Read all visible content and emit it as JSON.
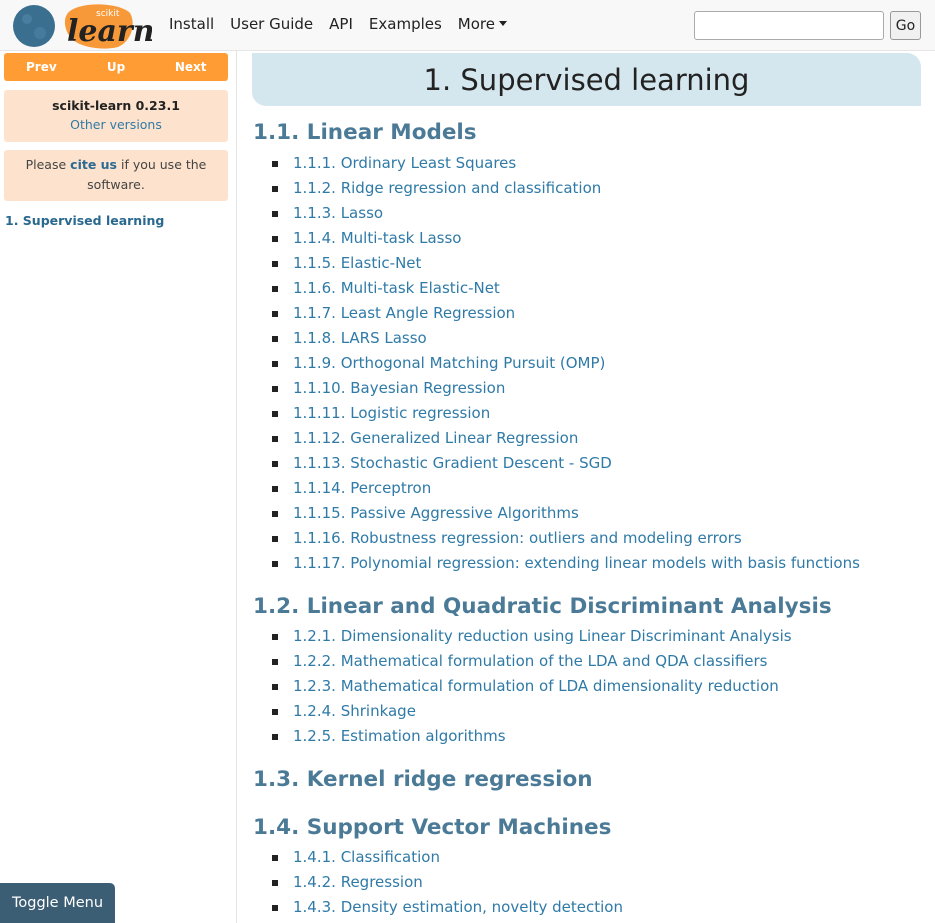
{
  "logo": {
    "small_text": "scikit",
    "big_text": "learn"
  },
  "nav": {
    "links": [
      "Install",
      "User Guide",
      "API",
      "Examples"
    ],
    "more_label": "More",
    "search_placeholder": "",
    "go_label": "Go"
  },
  "sidebar": {
    "prev": "Prev",
    "up": "Up",
    "next": "Next",
    "version": "scikit-learn 0.23.1",
    "other_versions": "Other versions",
    "cite_before": "Please ",
    "cite_link": "cite us",
    "cite_after": " if you use the software.",
    "current_page": "1. Supervised learning",
    "toggle_menu": "Toggle Menu"
  },
  "page": {
    "title": "1. Supervised learning",
    "sections": [
      {
        "heading": "1.1. Linear Models",
        "items": [
          "1.1.1. Ordinary Least Squares",
          "1.1.2. Ridge regression and classification",
          "1.1.3. Lasso",
          "1.1.4. Multi-task Lasso",
          "1.1.5. Elastic-Net",
          "1.1.6. Multi-task Elastic-Net",
          "1.1.7. Least Angle Regression",
          "1.1.8. LARS Lasso",
          "1.1.9. Orthogonal Matching Pursuit (OMP)",
          "1.1.10. Bayesian Regression",
          "1.1.11. Logistic regression",
          "1.1.12. Generalized Linear Regression",
          "1.1.13. Stochastic Gradient Descent - SGD",
          "1.1.14. Perceptron",
          "1.1.15. Passive Aggressive Algorithms",
          "1.1.16. Robustness regression: outliers and modeling errors",
          "1.1.17. Polynomial regression: extending linear models with basis functions"
        ]
      },
      {
        "heading": "1.2. Linear and Quadratic Discriminant Analysis",
        "items": [
          "1.2.1. Dimensionality reduction using Linear Discriminant Analysis",
          "1.2.2. Mathematical formulation of the LDA and QDA classifiers",
          "1.2.3. Mathematical formulation of LDA dimensionality reduction",
          "1.2.4. Shrinkage",
          "1.2.5. Estimation algorithms"
        ]
      },
      {
        "heading": "1.3. Kernel ridge regression",
        "items": []
      },
      {
        "heading": "1.4. Support Vector Machines",
        "items": [
          "1.4.1. Classification",
          "1.4.2. Regression",
          "1.4.3. Density estimation, novelty detection"
        ]
      }
    ]
  },
  "colors": {
    "accent_orange": "#ff9c34",
    "logo_blue": "#3499cd",
    "heading_blue": "#4b7a97",
    "link_blue": "#2f7aa7",
    "banner_bg": "#d5e7ee",
    "toggle_bg": "#3c5e74"
  }
}
